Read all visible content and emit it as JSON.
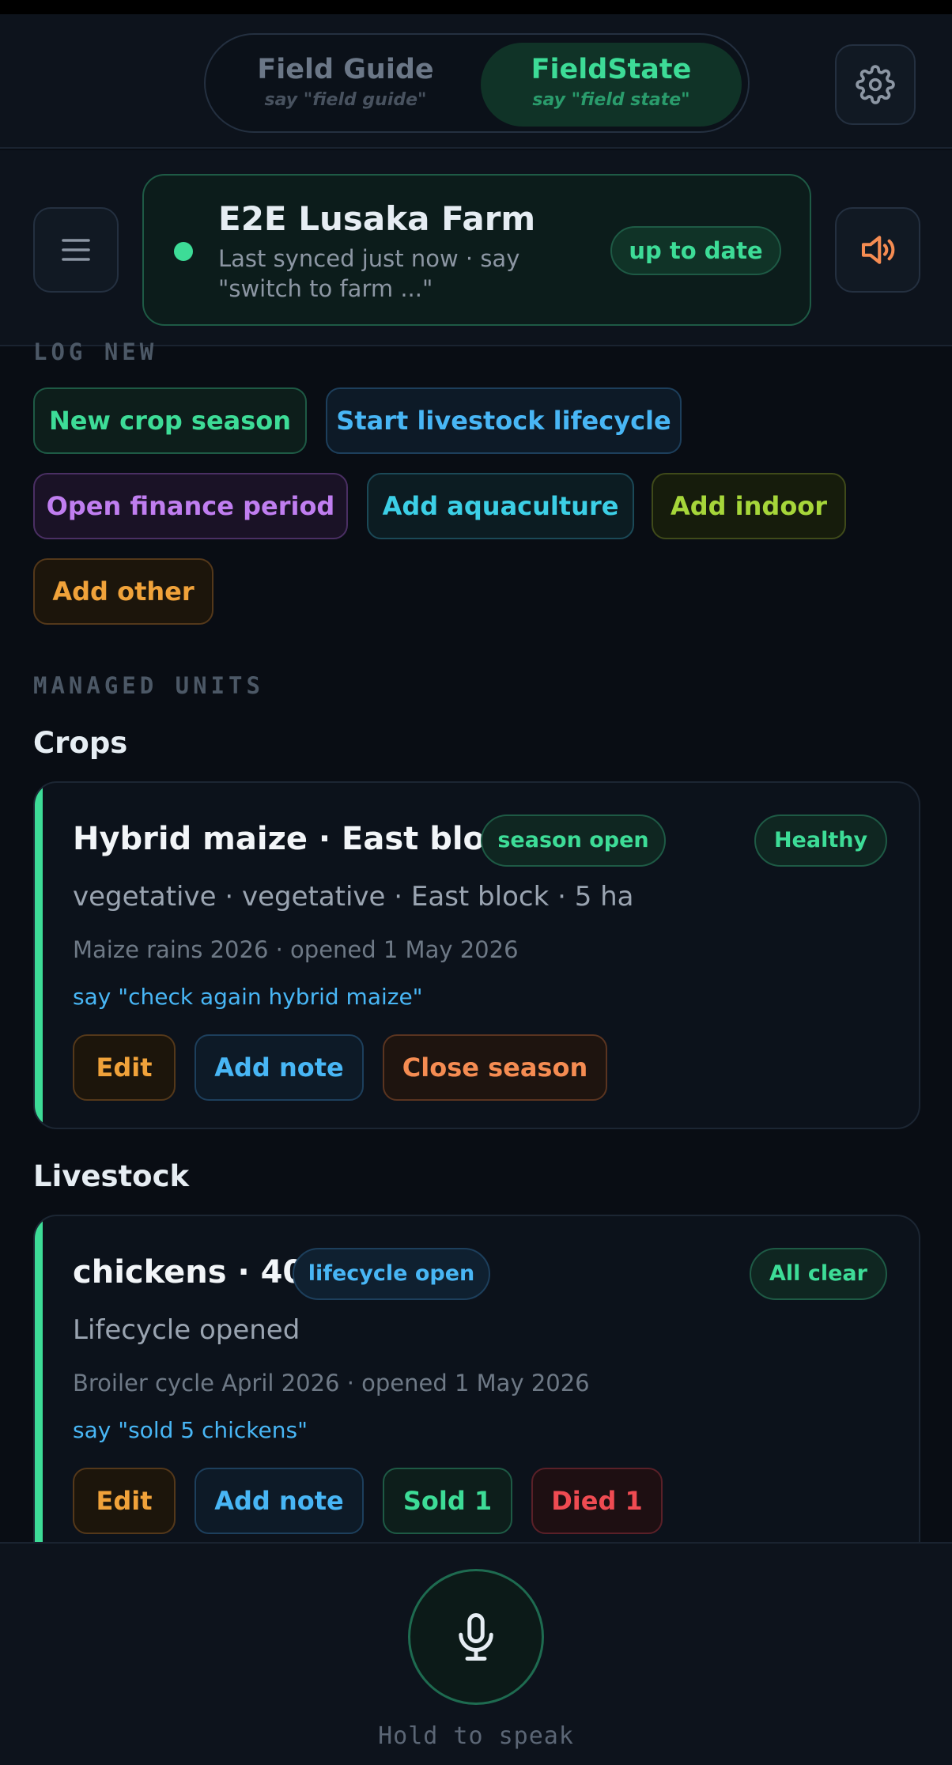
{
  "mode_toggle": {
    "field_guide": {
      "label": "Field Guide",
      "hint": "say \"field guide\""
    },
    "field_state": {
      "label": "FieldState",
      "hint": "say \"field state\""
    },
    "selected": "field_state"
  },
  "farm": {
    "name": "E2E Lusaka Farm",
    "sync_text": "Last synced just now · say \"switch to farm ...\"",
    "status": "up to date"
  },
  "log_new": {
    "heading": "LOG NEW",
    "actions": [
      {
        "label": "New crop season",
        "color": "#3ddc97"
      },
      {
        "label": "Start livestock lifecycle",
        "color": "#48b6f5"
      },
      {
        "label": "Open finance period",
        "color": "#c07ef0"
      },
      {
        "label": "Add aquaculture",
        "color": "#3ccfe6"
      },
      {
        "label": "Add indoor",
        "color": "#a6d63a"
      },
      {
        "label": "Add other",
        "color": "#f0a23a"
      }
    ]
  },
  "managed_units": {
    "heading": "MANAGED UNITS",
    "crops": {
      "title": "Crops",
      "card": {
        "name": "Hybrid maize · East block",
        "state_badge": "season open",
        "health_badge": "Healthy",
        "details": "vegetative · vegetative · East block · 5 ha",
        "period": "Maize rains 2026 · opened 1 May 2026",
        "voice_hint": "say \"check again hybrid maize\"",
        "buttons": {
          "edit": "Edit",
          "note": "Add note",
          "close": "Close season"
        }
      }
    },
    "livestock": {
      "title": "Livestock",
      "card": {
        "name": "chickens · 40",
        "state_badge": "lifecycle open",
        "health_badge": "All clear",
        "details": "Lifecycle opened",
        "period": "Broiler cycle April 2026 · opened 1 May 2026",
        "voice_hint": "say \"sold 5 chickens\"",
        "buttons": {
          "edit": "Edit",
          "note": "Add note",
          "sold": "Sold 1",
          "died": "Died 1"
        }
      }
    }
  },
  "footer": {
    "hint": "Hold to speak"
  },
  "colors": {
    "accent": "#3ddc97",
    "background": "#090d14"
  }
}
